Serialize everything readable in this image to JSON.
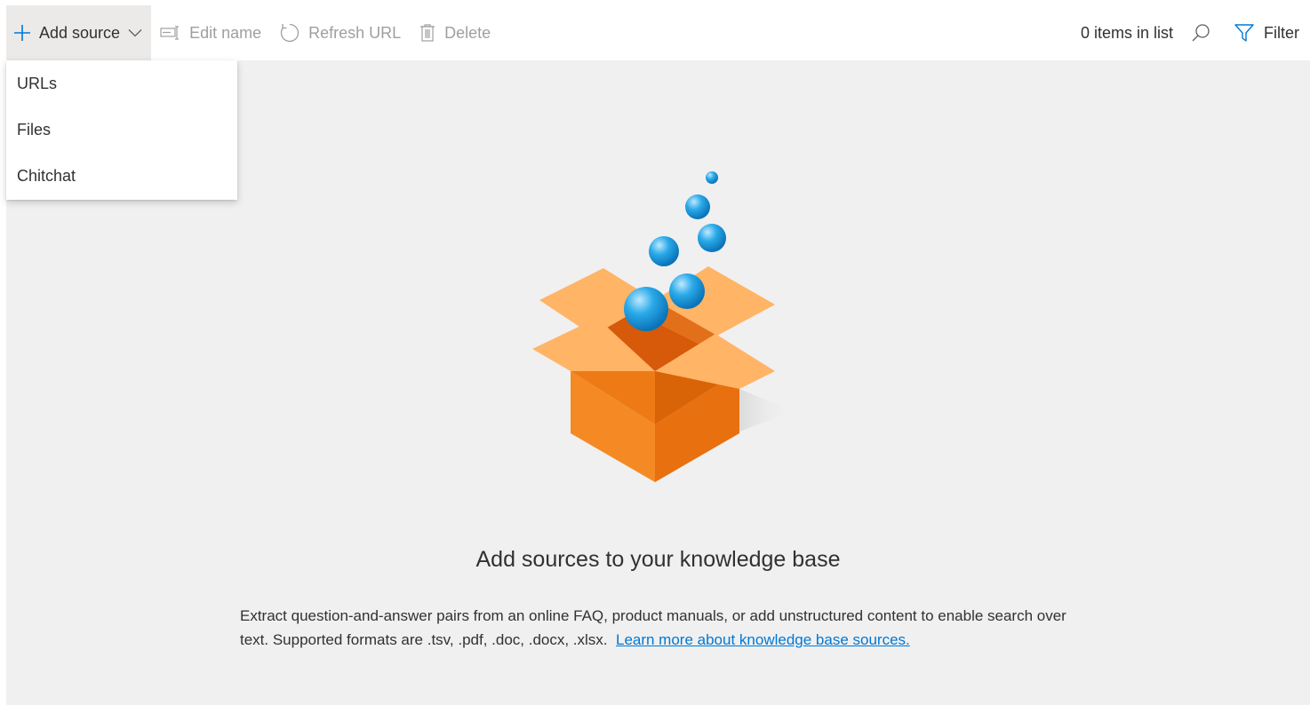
{
  "toolbar": {
    "add_source_label": "Add source",
    "edit_name_label": "Edit name",
    "refresh_url_label": "Refresh URL",
    "delete_label": "Delete",
    "items_count": "0 items in list",
    "filter_label": "Filter"
  },
  "dropdown": {
    "items": [
      "URLs",
      "Files",
      "Chitchat"
    ]
  },
  "empty_state": {
    "title": "Add sources to your knowledge base",
    "description": "Extract question-and-answer pairs from an online FAQ, product manuals, or add unstructured content to enable search over text. Supported formats are .tsv, .pdf, .doc, .docx, .xlsx.",
    "link_text": "Learn more about knowledge base sources."
  },
  "icons": {
    "add": "plus-icon",
    "chevron": "chevron-down-icon",
    "edit": "rename-icon",
    "refresh": "refresh-icon",
    "delete": "trash-icon",
    "search": "search-icon",
    "filter": "filter-icon"
  },
  "colors": {
    "accent": "#0078d4",
    "box_orange": "#f58220",
    "bubble_blue": "#1ea1e6"
  }
}
